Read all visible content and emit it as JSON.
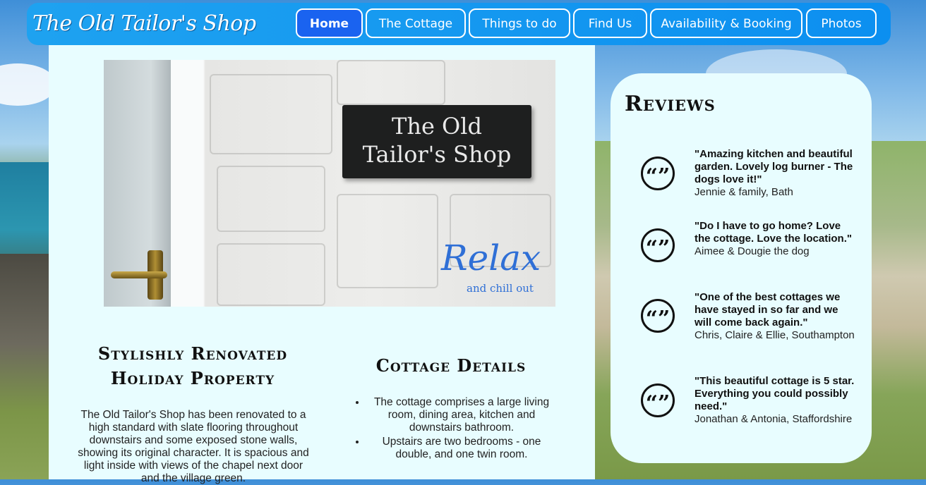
{
  "site": {
    "logo": "The Old Tailor's Shop"
  },
  "nav": [
    {
      "label": "Home",
      "active": true
    },
    {
      "label": "The Cottage",
      "active": false
    },
    {
      "label": "Things to do",
      "active": false
    },
    {
      "label": "Find Us",
      "active": false
    },
    {
      "label": "Availability & Booking",
      "active": false
    },
    {
      "label": "Photos",
      "active": false
    }
  ],
  "hero": {
    "sign_line1": "The Old",
    "sign_line2": "Tailor's Shop",
    "relax": "Relax",
    "relax_sub": "and chill out"
  },
  "intro": {
    "heading_line1": "Stylishly Renovated",
    "heading_line2": "Holiday Property",
    "body": "The Old Tailor's Shop has been renovated to a high standard with slate flooring throughout downstairs and some exposed stone walls, showing its original character. It is spacious and light inside with views of the chapel next door and the village green."
  },
  "details": {
    "heading": "Cottage Details",
    "items": [
      "The cottage comprises a large living room, dining area, kitchen and downstairs bathroom.",
      "Upstairs are two bedrooms - one double, and one twin room."
    ]
  },
  "reviews": {
    "title": "Reviews",
    "items": [
      {
        "quote": "\"Amazing kitchen and beautiful garden. Lovely log burner - The dogs love it!\"",
        "author": "Jennie & family, Bath"
      },
      {
        "quote": "\"Do I have to go home? Love the cottage. Love the location.\"",
        "author": "Aimee & Dougie the dog"
      },
      {
        "quote": "\"One of the best cottages we have stayed in so far and we will come back again.\"",
        "author": "Chris, Claire & Ellie, Southampton"
      },
      {
        "quote": "\"This beautiful cottage is 5 star. Everything you could possibly need.\"",
        "author": "Jonathan & Antonia, Staffordshire"
      }
    ],
    "quote_glyph": "“”"
  },
  "colors": {
    "nav_bg": "#0c8ff0",
    "nav_active": "#1a63f0",
    "panel_bg": "#e8fdff",
    "accent_text": "#2f6fd6"
  }
}
